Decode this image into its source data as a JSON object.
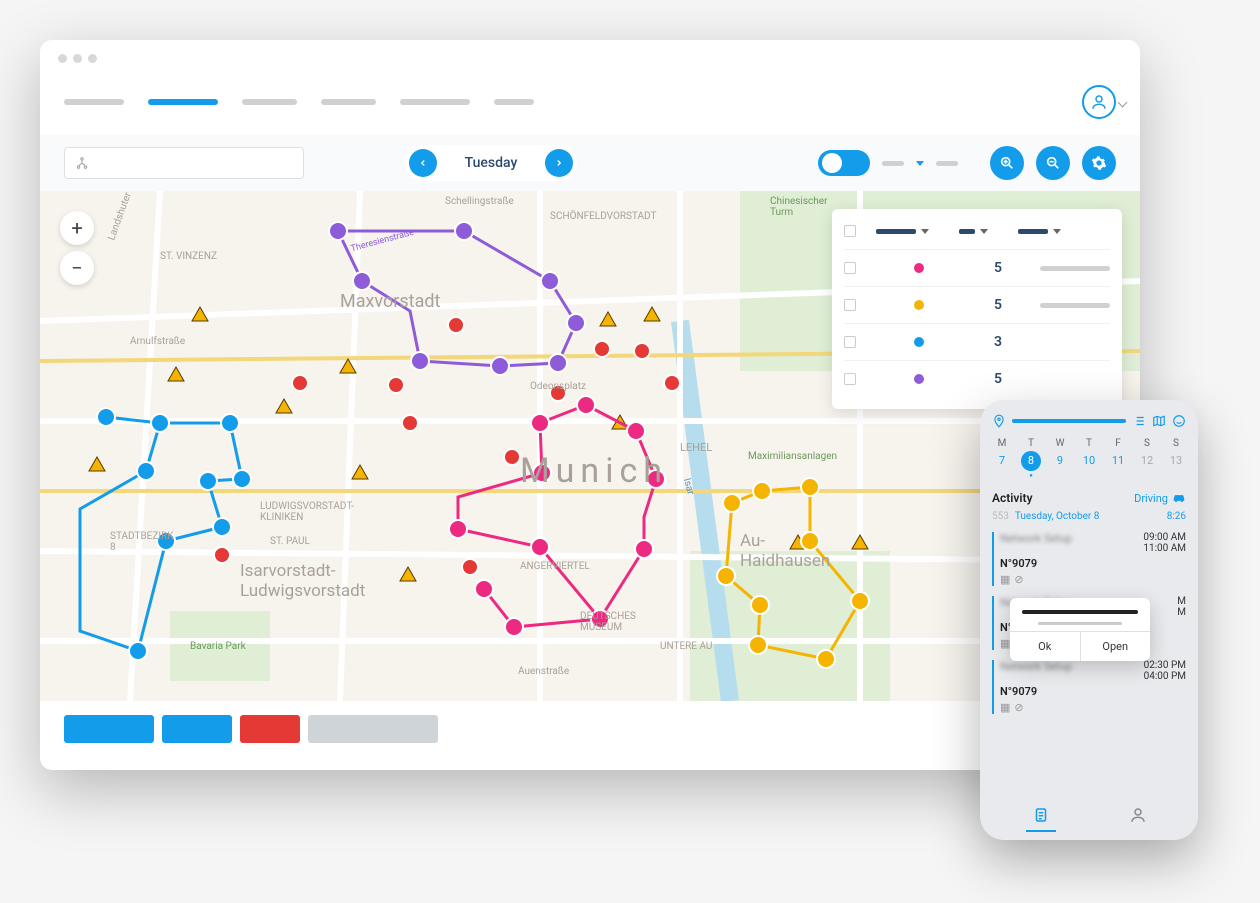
{
  "toolbar": {
    "day": "Tuesday"
  },
  "map": {
    "city": "Munich",
    "districts": {
      "maxvorstadt": "Maxvorstadt",
      "lehel": "LEHEL",
      "schonfeld": "SCHÖNFELDVORSTADT",
      "stvinzenz": "ST. VINZENZ",
      "stadtbezirk": "STADTBEZIRK\n8",
      "stpaul": "ST. PAUL",
      "isarvorstadt": "Isarvorstadt-\nLudwigsvorstadt",
      "ludwigsvorstadt": "LUDWIGSVORSTADT-\nKLINIKEN",
      "angerviertel": "ANGERVIERTEL",
      "au": "Au-\nHaidhausen",
      "unterer": "UNTERE AU",
      "bavariapark": "Bavaria Park",
      "maximiliansanlagen": "Maximiliansanlagen",
      "chinesischer": "Chinesischer\nTurm",
      "deutschesmuseum": "DEUTSCHES\nMUSEUM",
      "landshuter": "Landshuter",
      "arnulfstrasse": "Arnulfstraße",
      "odeonsplatz": "Odeonsplatz",
      "schellingstrasse": "Schellingstraße",
      "theresienstrasse": "Theresienstraße",
      "auenstrasse": "Auenstraße",
      "isar": "Isar"
    },
    "routes": {
      "purple": {
        "color": "#8e5bd9",
        "count": 5
      },
      "blue": {
        "color": "#139ce9",
        "count": 3
      },
      "pink": {
        "color": "#ec2a81",
        "count": 5
      },
      "yellow": {
        "color": "#f4b400",
        "count": 5
      }
    },
    "legend": [
      {
        "color": "#ec2a81",
        "count": "5"
      },
      {
        "color": "#f4b400",
        "count": "5"
      },
      {
        "color": "#139ce9",
        "count": "3"
      },
      {
        "color": "#8e5bd9",
        "count": "5"
      }
    ]
  },
  "phone": {
    "days": [
      "M",
      "T",
      "W",
      "T",
      "F",
      "S",
      "S"
    ],
    "dates": [
      "7",
      "8",
      "9",
      "10",
      "11",
      "12",
      "13"
    ],
    "active_date_index": 1,
    "activity_label": "Activity",
    "driving_label": "Driving",
    "sub_left": "Tuesday, October 8",
    "sub_time": "8:26",
    "items": [
      {
        "id": "N°9079",
        "t1": "09:00 AM",
        "t2": "11:00 AM"
      },
      {
        "id": "N°89",
        "t1": "M",
        "t2": "M"
      },
      {
        "id": "N°9079",
        "t1": "02:30 PM",
        "t2": "04:00 PM"
      }
    ],
    "popup": {
      "ok": "Ok",
      "open": "Open"
    }
  },
  "colors": {
    "accent": "#139ce9",
    "danger": "#e53935"
  }
}
